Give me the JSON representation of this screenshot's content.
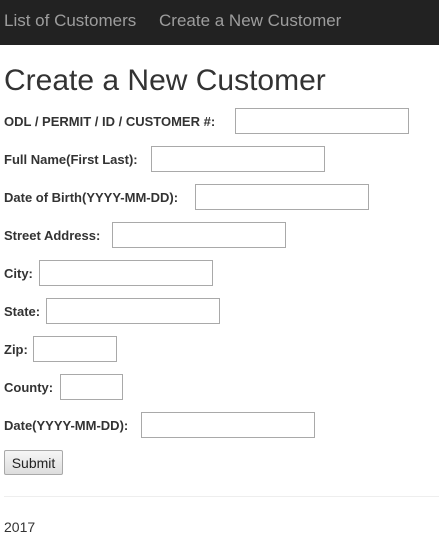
{
  "nav": {
    "list_label": "List of Customers",
    "create_label": "Create a New Customer"
  },
  "page": {
    "title": "Create a New Customer"
  },
  "form": {
    "odl_label": "ODL / PERMIT / ID / CUSTOMER #:",
    "name_label": "Full Name(First Last):",
    "dob_label": "Date of Birth(YYYY-MM-DD):",
    "street_label": "Street Address:",
    "city_label": "City:",
    "state_label": "State:",
    "zip_label": "Zip:",
    "county_label": "County:",
    "date_label": "Date(YYYY-MM-DD):",
    "submit_label": "Submit"
  },
  "footer": {
    "text": "2017"
  }
}
